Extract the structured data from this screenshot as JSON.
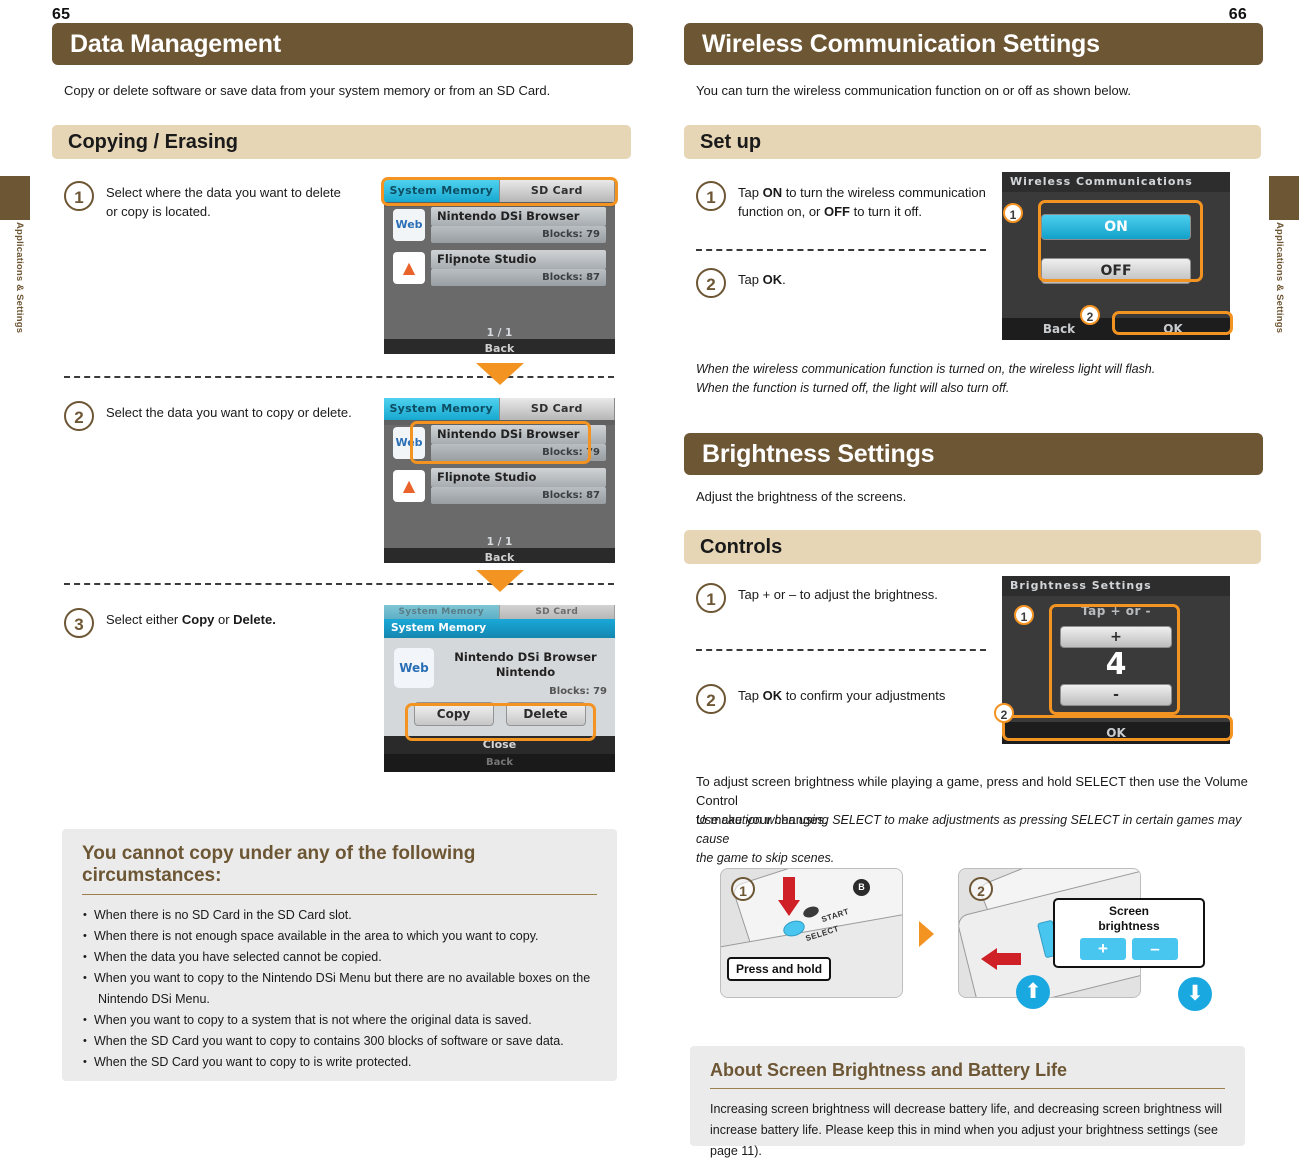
{
  "left_page": {
    "folio": "65",
    "thumb_tab_label": "Applications & Settings",
    "chapter_title": "Data Management",
    "intro": "Copy or delete software or save data from your system memory or from an SD Card.",
    "section_title": "Copying / Erasing",
    "steps": [
      {
        "num": "1",
        "text_line1": "Select where the data you want to delete",
        "text_line2": "or copy is located."
      },
      {
        "num": "2",
        "text_line1": "Select the data you want to copy or delete.",
        "text_line2": ""
      },
      {
        "num": "3",
        "text_prefix": "Select either ",
        "bold1": "Copy",
        "mid": " or ",
        "bold2": "Delete.",
        "text_line2": ""
      }
    ],
    "screens": [
      {
        "tabs": [
          {
            "label": "System Memory",
            "active": true
          },
          {
            "label": "SD Card",
            "active": false
          }
        ],
        "items": [
          {
            "icon": "web-icon",
            "icon_label": "Web",
            "name": "Nintendo DSi Browser",
            "blocks": "Blocks: 79"
          },
          {
            "icon": "flipnote-icon",
            "icon_label": "▲",
            "name": "Flipnote Studio",
            "blocks": "Blocks: 87"
          }
        ],
        "page_indicator": "1 / 1",
        "bottom_button": "Back",
        "highlight": "tabs"
      },
      {
        "tabs": [
          {
            "label": "System Memory",
            "active": true
          },
          {
            "label": "SD Card",
            "active": false
          }
        ],
        "items": [
          {
            "icon": "web-icon",
            "icon_label": "Web",
            "name": "Nintendo DSi Browser",
            "blocks": "Blocks: 79"
          },
          {
            "icon": "flipnote-icon",
            "icon_label": "▲",
            "name": "Flipnote Studio",
            "blocks": "Blocks: 87"
          }
        ],
        "page_indicator": "1 / 1",
        "bottom_button": "Back",
        "highlight": "first-item"
      },
      {
        "tabs": [
          {
            "label": "System Memory",
            "active": true
          },
          {
            "label": "SD Card",
            "active": false
          }
        ],
        "dialog_title": "System Memory",
        "dialog_icon_label": "Web",
        "dialog_app_name": "Nintendo DSi Browser",
        "dialog_publisher": "Nintendo",
        "dialog_blocks": "Blocks: 79",
        "dialog_buttons": [
          "Copy",
          "Delete"
        ],
        "dialog_close": "Close",
        "bottom_button": "Back",
        "highlight": "copy-delete"
      }
    ],
    "warning_box": {
      "title": "You cannot copy under any of the following circumstances:",
      "items": [
        "When there is no SD Card in the SD Card slot.",
        "When there is not enough space available in the area to which you want to copy.",
        "When the data you have selected cannot be copied.",
        "When you want to copy to the Nintendo DSi Menu but there are no available boxes on the",
        "Nintendo DSi Menu.",
        "When you want to copy to a system that is not where the original data is saved.",
        "When the SD Card you want to copy to contains 300 blocks of software or save data.",
        "When the SD Card you want to copy to is write protected."
      ],
      "continuation_indices": [
        4
      ]
    }
  },
  "right_page": {
    "folio": "66",
    "thumb_tab_label": "Applications & Settings",
    "chapter_title": "Wireless Communication Settings",
    "intro": "You can turn the wireless communication function on or off as shown below.",
    "section_title": "Set up",
    "wireless_steps": [
      {
        "num": "1",
        "prefix": "Tap ",
        "bold1": "ON",
        "mid": " to turn the wireless communication",
        "line2_prefix": "function on, or ",
        "bold2": "OFF",
        "line2_suffix": " to turn it off."
      },
      {
        "num": "2",
        "prefix": "Tap ",
        "bold1": "OK",
        "mid": ".",
        "line2_prefix": "",
        "bold2": "",
        "line2_suffix": ""
      }
    ],
    "wireless_note_line1": "When the wireless communication function is turned on, the wireless light will flash.",
    "wireless_note_line2": "When the function is turned off, the light will also turn off.",
    "wireless_screen": {
      "title": "Wireless Communications",
      "on_label": "ON",
      "off_label": "OFF",
      "back_label": "Back",
      "ok_label": "OK",
      "badge1": "1",
      "badge2": "2"
    },
    "brightness_chapter_title": "Brightness Settings",
    "brightness_intro": "Adjust the brightness of the screens.",
    "brightness_section_title": "Controls",
    "brightness_steps": [
      {
        "num": "1",
        "prefix": "Tap + or – to adjust the brightness.",
        "bold1": "",
        "mid": ""
      },
      {
        "num": "2",
        "prefix": "Tap ",
        "bold1": "OK",
        "mid": " to confirm your adjustments"
      }
    ],
    "brightness_screen": {
      "title": "Brightness Settings",
      "subtitle": "Tap + or -",
      "plus_label": "+",
      "value": "4",
      "minus_label": "-",
      "ok_label": "OK",
      "badge1": "1",
      "badge2": "2"
    },
    "select_note_line1": "To adjust screen brightness while playing a game, press and hold SELECT then use the Volume Control",
    "select_note_line2": "to make your changes.",
    "select_note_italic1": "Use caution when using SELECT to make adjustments as pressing SELECT in certain games may cause",
    "select_note_italic2": "the game to skip scenes.",
    "illustration": {
      "panel1_num": "1",
      "panel1_callout": "Press and hold",
      "panel1_start_label": "START",
      "panel1_select_label": "SELECT",
      "panel1_b_label": "B",
      "panel2_num": "2",
      "panel2_callout_line1": "Screen",
      "panel2_callout_line2": "brightness",
      "panel2_plus": "+",
      "panel2_minus": "–",
      "up_arrow": "⬆",
      "down_arrow": "⬇"
    },
    "battery_box": {
      "title": "About Screen Brightness and Battery Life",
      "line1": "Increasing screen brightness will decrease battery life, and decreasing screen brightness will",
      "line2": "increase battery life. Please keep this in mind when you adjust your brightness settings (see page 11)."
    }
  },
  "colors": {
    "chapter_brown": "#6d5634",
    "section_tan": "#e6d6b6",
    "accent_orange": "#f39322",
    "box_grey": "#ebebeb",
    "highlight_blue": "#1aa8e0",
    "red_arrow": "#cf2027"
  }
}
